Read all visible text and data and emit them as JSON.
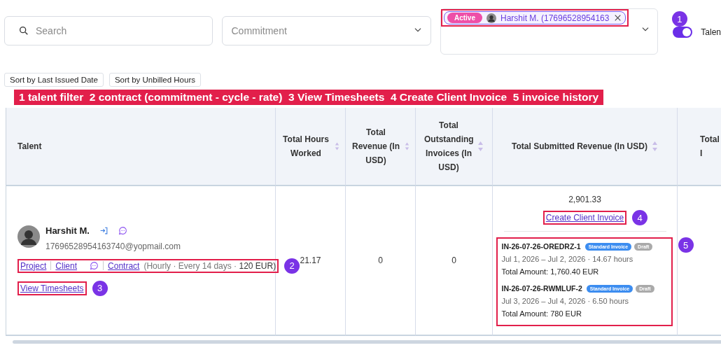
{
  "filters": {
    "search": {
      "placeholder": "Search"
    },
    "commitment": {
      "placeholder": "Commitment"
    },
    "talent": {
      "chips": [
        {
          "status": "Active",
          "name": "Harshit M. (17696528954163"
        }
      ],
      "callout": "1"
    },
    "toggle": {
      "on": true,
      "label": "Talen"
    }
  },
  "sort_buttons": [
    "Sort by Last Issued Date",
    "Sort by Unbilled Hours"
  ],
  "legend": "1 talent filter  2 contract (commitment - cycle - rate)  3 View Timesheets  4 Create Client Invoice  5 invoice history",
  "table": {
    "columns": [
      {
        "label": "Talent",
        "sortable": false
      },
      {
        "label": "Total Hours Worked",
        "sortable": true
      },
      {
        "label": "Total Revenue (In USD)",
        "sortable": true
      },
      {
        "label": "Total Outstanding Invoices (In USD)",
        "sortable": true
      },
      {
        "label": "Total Submitted Revenue (In USD)",
        "sortable": true
      },
      {
        "label": "Total I"
      }
    ],
    "rows": [
      {
        "talent": {
          "name": "Harshit M.",
          "email": "17696528954163740@yopmail.com",
          "links": {
            "project": "Project",
            "client": "Client",
            "contract": "Contract",
            "terms": "(Hourly · Every 14 days · **120 EUR)**",
            "callout": "2"
          },
          "timesheets": {
            "label": "View Timesheets",
            "callout": "3"
          }
        },
        "hours": "21.17",
        "revenue": "0",
        "outstanding": "0",
        "submitted": {
          "total": "2,901.33",
          "create_invoice": {
            "label": "Create Client Invoice",
            "callout": "4"
          },
          "invoices_callout": "5",
          "invoices": [
            {
              "number": "IN-26-07-26-OREDRZ-1",
              "tags": [
                {
                  "label": "Standard Invoice",
                  "kind": "type"
                },
                {
                  "label": "Draft",
                  "kind": "status"
                }
              ],
              "period": "Jul 1, 2026 – Jul 2, 2026 · 14.67 hours",
              "amount": "Total Amount: 1,760.40 EUR"
            },
            {
              "number": "IN-26-07-26-RWMLUF-2",
              "tags": [
                {
                  "label": "Standard Invoice",
                  "kind": "type"
                },
                {
                  "label": "Draft",
                  "kind": "status"
                }
              ],
              "period": "Jul 3, 2026 – Jul 4, 2026 · 6.50 hours",
              "amount": "Total Amount: 780 EUR"
            }
          ]
        }
      }
    ]
  }
}
